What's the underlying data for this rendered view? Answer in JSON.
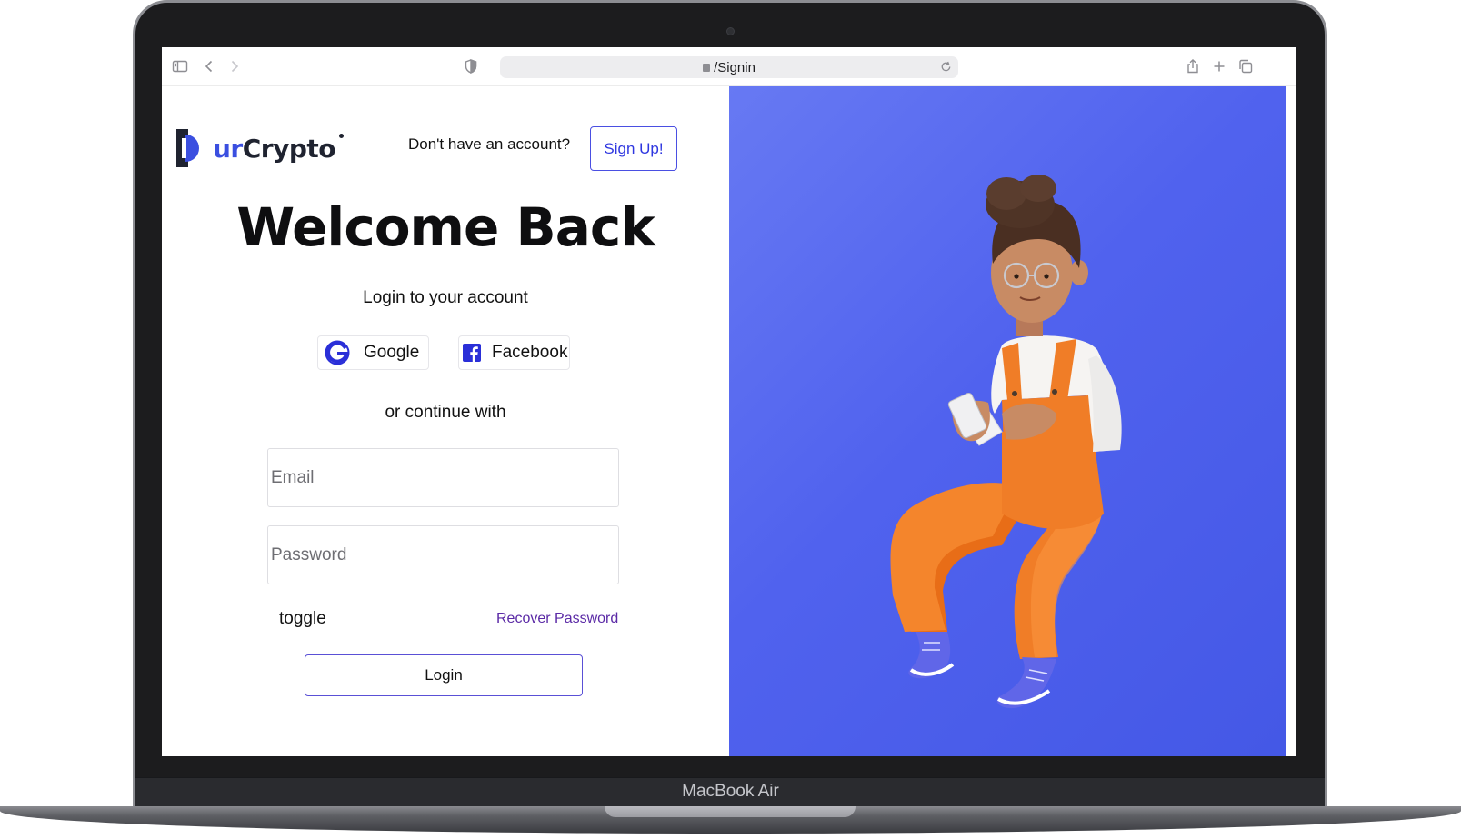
{
  "device": {
    "label": "MacBook Air"
  },
  "browser": {
    "url": "/Signin"
  },
  "header": {
    "logo": {
      "prefix": "ur",
      "suffix": "Crypto"
    },
    "signup_prompt": "Don't have an account?",
    "signup_button": "Sign Up!"
  },
  "login": {
    "title": "Welcome Back",
    "subtitle": "Login to your account",
    "social": {
      "google": "Google",
      "facebook": "Facebook"
    },
    "divider": "or continue with",
    "email_placeholder": "Email",
    "password_placeholder": "Password",
    "toggle_label": "toggle",
    "recover_link": "Recover Password",
    "login_button": "Login"
  },
  "colors": {
    "accent": "#3b4fe0",
    "panel_blue": "#5062ee",
    "link_purple": "#5b2aa6",
    "overalls_orange": "#f07d27"
  },
  "icons": [
    "sidebar-icon",
    "back-icon",
    "forward-icon",
    "shield-icon",
    "lock-icon",
    "reload-icon",
    "share-icon",
    "new-tab-icon",
    "tabs-overview-icon",
    "google-icon",
    "facebook-icon"
  ]
}
